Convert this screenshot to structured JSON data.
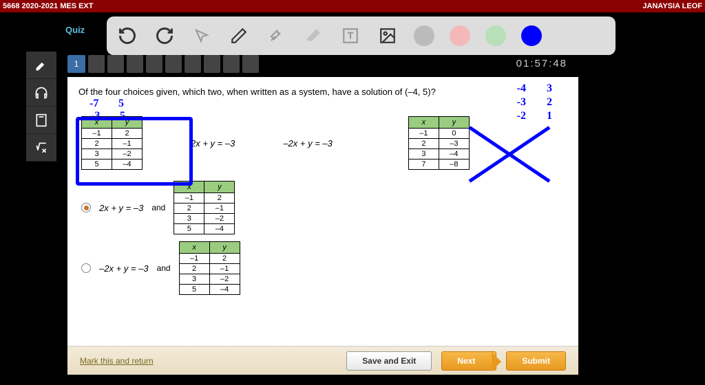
{
  "topbar": {
    "left": "5668 2020-2021 MES EXT",
    "right": "JANAYSIA LEOF"
  },
  "quiz_label": "Quiz",
  "question_number": "1",
  "timer": "01:57:48",
  "question_text": "Of the four choices given, which two, when written as a system, have a solution of (–4, 5)?",
  "table1": {
    "hx": "x",
    "hy": "y",
    "r": [
      [
        "–1",
        "2"
      ],
      [
        "2",
        "–1"
      ],
      [
        "3",
        "–2"
      ],
      [
        "5",
        "–4"
      ]
    ]
  },
  "eq1": "2x + y = –3",
  "eq2": "–2x + y = –3",
  "table2": {
    "hx": "x",
    "hy": "y",
    "r": [
      [
        "–1",
        "0"
      ],
      [
        "2",
        "–3"
      ],
      [
        "3",
        "–4"
      ],
      [
        "7",
        "–8"
      ]
    ]
  },
  "options": {
    "a_eq": "2x + y = –3",
    "a_and": "and",
    "b_eq": "–2x + y = –3",
    "b_and": "and"
  },
  "opt_table": {
    "hx": "x",
    "hy": "y",
    "r": [
      [
        "–1",
        "2"
      ],
      [
        "2",
        "–1"
      ],
      [
        "3",
        "–2"
      ],
      [
        "5",
        "–4"
      ]
    ]
  },
  "footer": {
    "mark": "Mark this and return",
    "save": "Save and Exit",
    "next": "Next",
    "submit": "Submit"
  },
  "handwriting": {
    "tl1": "-7",
    "tl2": "5",
    "tl3": "-3",
    "tl4": "5",
    "tr1": "-4",
    "tr2": "3",
    "tr3": "-3",
    "tr4": "2",
    "tr5": "-2",
    "tr6": "1"
  },
  "colors": {
    "gray": "#bbbbbb",
    "pink": "#f5b8b8",
    "green": "#b8e0b8",
    "blue": "#0000ff"
  }
}
